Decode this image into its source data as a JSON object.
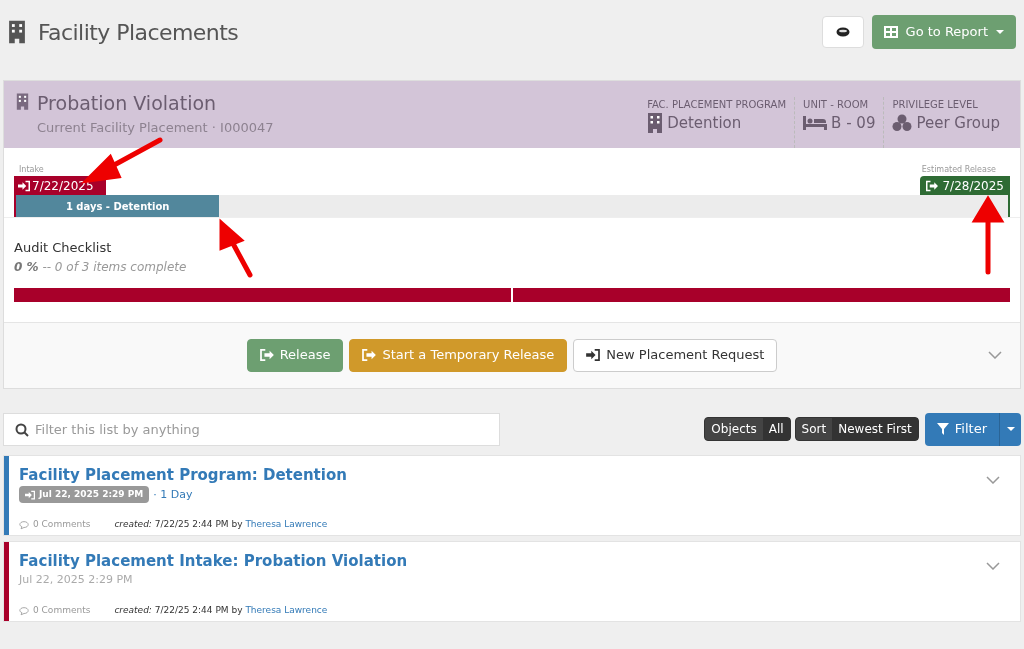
{
  "page": {
    "title": "Facility Placements"
  },
  "header_buttons": {
    "report": "Go to Report"
  },
  "placement": {
    "title": "Probation Violation",
    "subtitle": "Current Facility Placement · I000047",
    "facts": [
      {
        "label": "FAC. PLACEMENT PROGRAM",
        "value": "Detention",
        "kind": "building"
      },
      {
        "label": "UNIT - ROOM",
        "value": "B - 09",
        "kind": "bed"
      },
      {
        "label": "PRIVILEGE LEVEL",
        "value": "Peer Group",
        "kind": "cubes"
      }
    ],
    "timeline": {
      "intake_label": "Intake",
      "intake_date": "7/22/2025",
      "release_label": "Estimated Release",
      "release_date": "7/28/2025",
      "bar_text": "1 days - Detention",
      "level": 0.205
    },
    "checklist": {
      "title": "Audit Checklist",
      "percent": "0 %",
      "summary": "-- 0 of 3 items complete",
      "segments": [
        {
          "complete": false
        },
        {
          "complete": false
        }
      ]
    },
    "actions": [
      "Release",
      "Start a Temporary Release",
      "New Placement Request"
    ]
  },
  "list_toolbar": {
    "search_placeholder": "Filter this list by anything",
    "objects_label": "Objects",
    "objects_value": "All",
    "sort_label": "Sort",
    "sort_value": "Newest First",
    "filter": "Filter"
  },
  "entries": [
    {
      "title": "Facility Placement Program: Detention",
      "color": "#337ab7",
      "kind": "program",
      "date": "Jul 22, 2025 2:29 PM",
      "duration": "· 1 Day",
      "comments": "0 Comments",
      "created_label": "created:",
      "created": "7/22/25 2:44 PM by",
      "author": "Theresa Lawrence"
    },
    {
      "title": "Facility Placement Intake: Probation Violation",
      "color": "#a8002a",
      "kind": "intake",
      "date": "Jul 22, 2025 2:29 PM",
      "comments": "0 Comments",
      "created_label": "created:",
      "created": "7/22/25 2:44 PM by",
      "author": "Theresa Lawrence"
    }
  ]
}
